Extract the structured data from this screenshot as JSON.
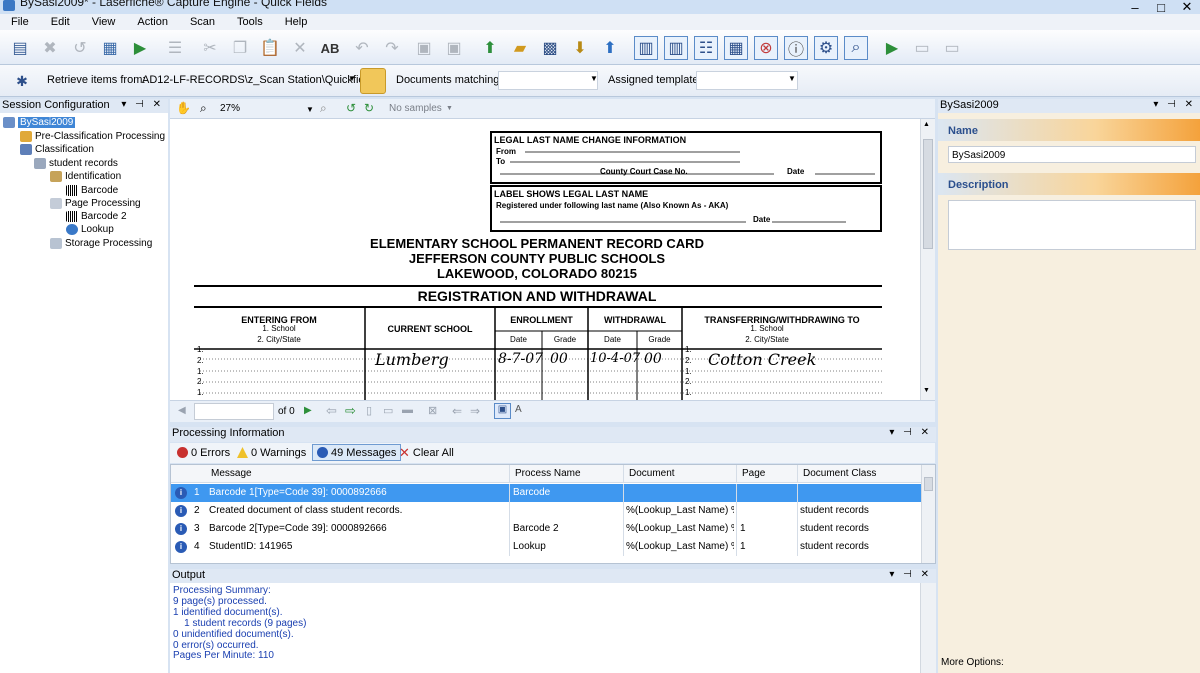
{
  "window": {
    "title": "BySasi2009* - Laserfiche® Capture Engine - Quick Fields"
  },
  "menu": [
    "File",
    "Edit",
    "View",
    "Action",
    "Scan",
    "Tools",
    "Help"
  ],
  "toolbar2": {
    "retrieve_label": "Retrieve items from:",
    "retrieve_value": "AD12-LF-RECORDS\\z_Scan Station\\Quickfield",
    "documents_matching_label": "Documents matching:",
    "assigned_template_label": "Assigned template:"
  },
  "session_panel": {
    "title": "Session Configuration",
    "tree": [
      {
        "label": "BySasi2009",
        "level": 0,
        "selected": true
      },
      {
        "label": "Pre-Classification Processing",
        "level": 1
      },
      {
        "label": "Classification",
        "level": 1
      },
      {
        "label": "student records",
        "level": 2
      },
      {
        "label": "Identification",
        "level": 3
      },
      {
        "label": "Barcode",
        "level": 4
      },
      {
        "label": "Page Processing",
        "level": 3
      },
      {
        "label": "Barcode 2",
        "level": 4
      },
      {
        "label": "Lookup",
        "level": 4
      },
      {
        "label": "Storage Processing",
        "level": 3
      }
    ]
  },
  "viewer": {
    "zoom": "27%",
    "samples": "No samples",
    "page_of": "of 0"
  },
  "document": {
    "box1_title": "LEGAL LAST NAME CHANGE INFORMATION",
    "box1_from": "From",
    "box1_to": "To",
    "box1_court": "County Court Case No.",
    "box1_date": "Date",
    "box2_title": "LABEL SHOWS LEGAL LAST NAME",
    "box2_line": "Registered under following last name (Also Known As - AKA)",
    "box2_date": "Date",
    "heading1": "ELEMENTARY SCHOOL PERMANENT RECORD CARD",
    "heading2": "JEFFERSON COUNTY PUBLIC SCHOOLS",
    "heading3": "LAKEWOOD, COLORADO 80215",
    "section": "REGISTRATION AND WITHDRAWAL",
    "col_entering": "ENTERING FROM",
    "col_entering_sub1": "1. School",
    "col_entering_sub2": "2. City/State",
    "col_current": "CURRENT SCHOOL",
    "col_enrollment": "ENROLLMENT",
    "col_withdrawal": "WITHDRAWAL",
    "col_date": "Date",
    "col_grade": "Grade",
    "col_transfer": "TRANSFERRING/WITHDRAWING TO",
    "col_transfer_sub1": "1. School",
    "col_transfer_sub2": "2. City/State",
    "hand_school": "Lumberg",
    "hand_enroll_date": "8-7-07",
    "hand_enroll_grade": "00",
    "hand_withdraw_date": "10-4-07",
    "hand_withdraw_grade": "00",
    "hand_transfer": "Cotton Creek"
  },
  "processing": {
    "title": "Processing Information",
    "tabs": {
      "errors": "0 Errors",
      "warnings": "0 Warnings",
      "messages": "49 Messages",
      "clear": "Clear All"
    },
    "columns": [
      "Message",
      "Process Name",
      "Document",
      "Page",
      "Document Class"
    ],
    "rows": [
      {
        "num": "1",
        "message": "Barcode 1[Type=Code 39]: 0000892666",
        "process": "Barcode",
        "document": "",
        "page": "",
        "class": "",
        "selected": true
      },
      {
        "num": "2",
        "message": "Created document of class student records.",
        "process": "",
        "document": "%(Lookup_Last Name) %...",
        "page": "",
        "class": "student records"
      },
      {
        "num": "3",
        "message": "Barcode 2[Type=Code 39]: 0000892666",
        "process": "Barcode 2",
        "document": "%(Lookup_Last Name) %...",
        "page": "1",
        "class": "student records"
      },
      {
        "num": "4",
        "message": "StudentID: 141965",
        "process": "Lookup",
        "document": "%(Lookup_Last Name) %...",
        "page": "1",
        "class": "student records"
      }
    ]
  },
  "output": {
    "title": "Output",
    "lines": [
      "Processing Summary:",
      "9 page(s) processed.",
      "1 identified document(s).",
      "    1 student records (9 pages)",
      "0 unidentified document(s).",
      "0 error(s) occurred.",
      "Pages Per Minute: 110"
    ]
  },
  "properties": {
    "title": "BySasi2009",
    "name_label": "Name",
    "name_value": "BySasi2009",
    "description_label": "Description",
    "more_options": "More Options:"
  }
}
